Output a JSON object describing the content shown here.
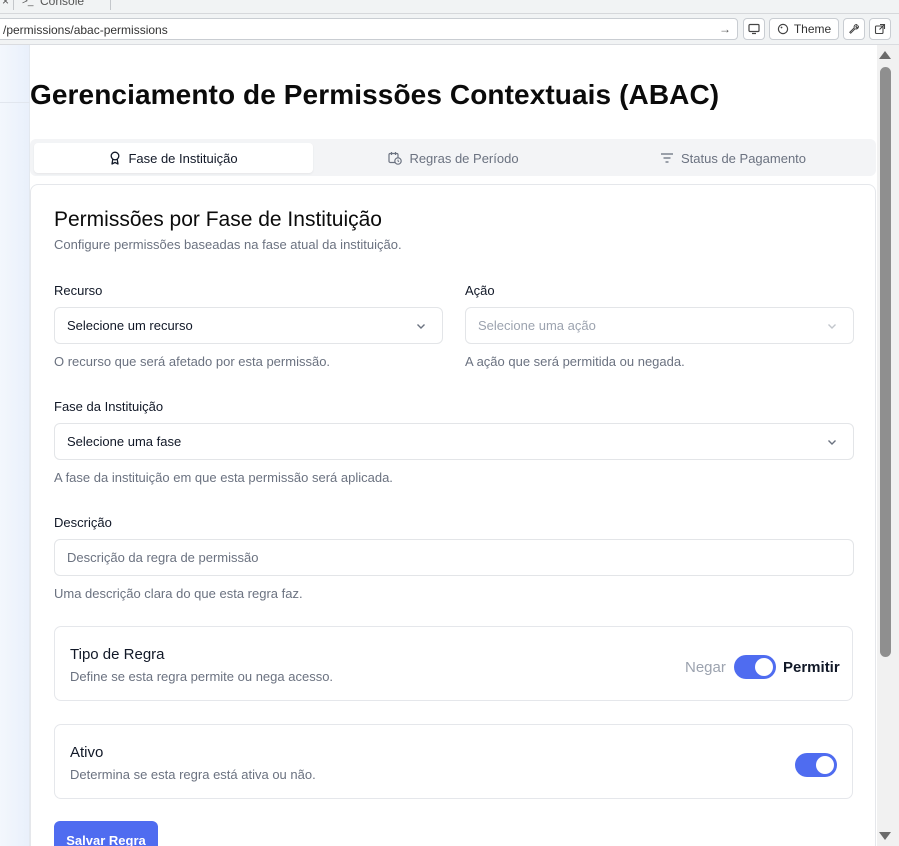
{
  "browser": {
    "tab_fragment": "Console",
    "url": "/permissions/abac-permissions",
    "theme_label": "Theme"
  },
  "page": {
    "title": "Gerenciamento de Permissões Contextuais (ABAC)"
  },
  "tabs": [
    {
      "label": "Fase de Instituição",
      "icon": "award-icon",
      "active": true
    },
    {
      "label": "Regras de Período",
      "icon": "calendar-clock-icon",
      "active": false
    },
    {
      "label": "Status de Pagamento",
      "icon": "filter-lines-icon",
      "active": false
    }
  ],
  "form": {
    "title": "Permissões por Fase de Instituição",
    "subtitle": "Configure permissões baseadas na fase atual da instituição.",
    "resource": {
      "label": "Recurso",
      "value": "Selecione um recurso",
      "help": "O recurso que será afetado por esta permissão."
    },
    "action": {
      "label": "Ação",
      "value": "Selecione uma ação",
      "help": "A ação que será permitida ou negada.",
      "disabled": true
    },
    "phase": {
      "label": "Fase da Instituição",
      "value": "Selecione uma fase",
      "help": "A fase da instituição em que esta permissão será aplicada."
    },
    "description": {
      "label": "Descrição",
      "placeholder": "Descrição da regra de permissão",
      "help": "Uma descrição clara do que esta regra faz."
    },
    "rule_type": {
      "title": "Tipo de Regra",
      "subtitle": "Define se esta regra permite ou nega acesso.",
      "deny_label": "Negar",
      "allow_label": "Permitir",
      "value": "Permitir"
    },
    "active": {
      "title": "Ativo",
      "subtitle": "Determina se esta regra está ativa ou não.",
      "value": true
    },
    "save_label": "Salvar Regra"
  },
  "colors": {
    "accent": "#4f6cf0",
    "muted_text": "#6b7280",
    "border": "#e5e7eb"
  }
}
